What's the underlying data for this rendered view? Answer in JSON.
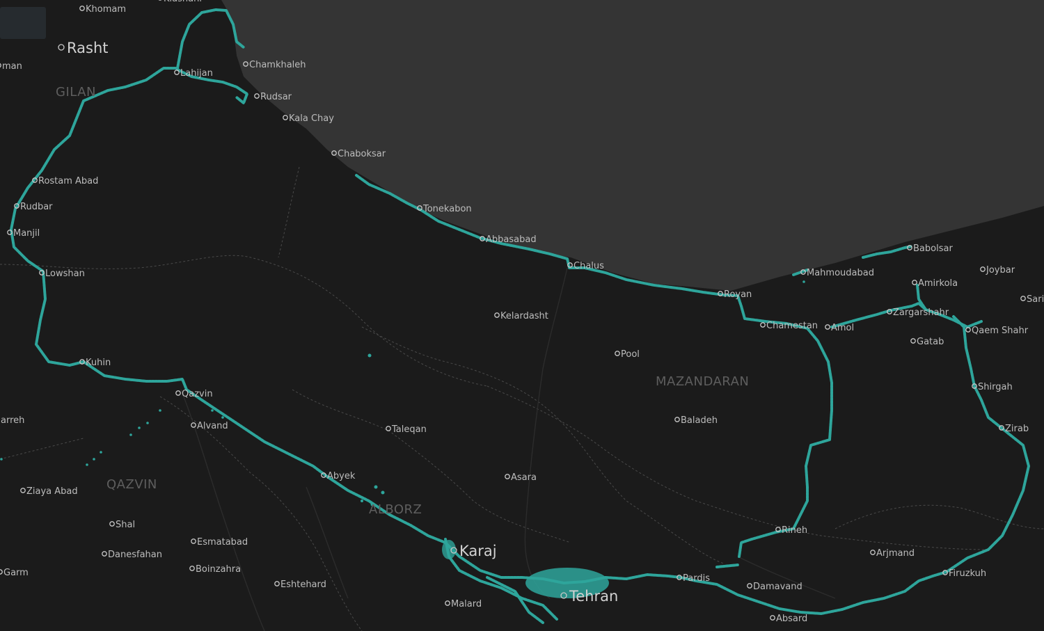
{
  "map": {
    "colors": {
      "land": "#1b1b1b",
      "sea": "#343434",
      "border": "#4a4a4a",
      "route": "#2ea59b",
      "label": "#bdbdbd",
      "region": "#5e5e5e"
    },
    "regions": [
      {
        "id": "gilan",
        "name": "GILAN"
      },
      {
        "id": "mazandaran",
        "name": "MAZANDARAN"
      },
      {
        "id": "qazvin",
        "name": "QAZVIN"
      },
      {
        "id": "alborz",
        "name": "ALBORZ"
      }
    ],
    "cities": [
      {
        "id": "khomam",
        "name": "Khomam"
      },
      {
        "id": "kiashahr",
        "name": "Kiashahr"
      },
      {
        "id": "rasht",
        "name": "Rasht"
      },
      {
        "id": "soman",
        "name": "man"
      },
      {
        "id": "lahijan",
        "name": "Lahijan"
      },
      {
        "id": "chamkhaleh",
        "name": "Chamkhaleh"
      },
      {
        "id": "rudsar",
        "name": "Rudsar"
      },
      {
        "id": "kalachay",
        "name": "Kala Chay"
      },
      {
        "id": "chaboksar",
        "name": "Chaboksar"
      },
      {
        "id": "rostamabad",
        "name": "Rostam Abad"
      },
      {
        "id": "rudbar",
        "name": "Rudbar"
      },
      {
        "id": "manjil",
        "name": "Manjil"
      },
      {
        "id": "lowshan",
        "name": "Lowshan"
      },
      {
        "id": "tonekabon",
        "name": "Tonekabon"
      },
      {
        "id": "abbasabad",
        "name": "Abbasabad"
      },
      {
        "id": "chalus",
        "name": "Chalus"
      },
      {
        "id": "kelardasht",
        "name": "Kelardasht"
      },
      {
        "id": "royan",
        "name": "Royan"
      },
      {
        "id": "chamestan",
        "name": "Chamestan"
      },
      {
        "id": "amol",
        "name": "Amol"
      },
      {
        "id": "mahmoudabad",
        "name": "Mahmoudabad"
      },
      {
        "id": "babolsar",
        "name": "Babolsar"
      },
      {
        "id": "joybar",
        "name": "Joybar"
      },
      {
        "id": "amirkola",
        "name": "Amirkola"
      },
      {
        "id": "sari",
        "name": "Sari"
      },
      {
        "id": "zargarshahr",
        "name": "Zargarshahr"
      },
      {
        "id": "qaemshahr",
        "name": "Qaem Shahr"
      },
      {
        "id": "gatab",
        "name": "Gatab"
      },
      {
        "id": "pool",
        "name": "Pool"
      },
      {
        "id": "shirgah",
        "name": "Shirgah"
      },
      {
        "id": "zirab",
        "name": "Zirab"
      },
      {
        "id": "baladeh",
        "name": "Baladeh"
      },
      {
        "id": "kuhin",
        "name": "Kuhin"
      },
      {
        "id": "qazvincity",
        "name": "Qazvin"
      },
      {
        "id": "alvand",
        "name": "Alvand"
      },
      {
        "id": "taleqan",
        "name": "Taleqan"
      },
      {
        "id": "takestan",
        "name": "arreh"
      },
      {
        "id": "abyek",
        "name": "Abyek"
      },
      {
        "id": "asara",
        "name": "Asara"
      },
      {
        "id": "ziaabad",
        "name": "Ziaya Abad"
      },
      {
        "id": "shal",
        "name": "Shal"
      },
      {
        "id": "esmatabad",
        "name": "Esmatabad"
      },
      {
        "id": "danesfahan",
        "name": "Danesfahan"
      },
      {
        "id": "boinzahra",
        "name": "Boinzahra"
      },
      {
        "id": "garm",
        "name": "Garm"
      },
      {
        "id": "eshtehard",
        "name": "Eshtehard"
      },
      {
        "id": "karaj",
        "name": "Karaj"
      },
      {
        "id": "malard",
        "name": "Malard"
      },
      {
        "id": "tehran",
        "name": "Tehran"
      },
      {
        "id": "pardis",
        "name": "Pardis"
      },
      {
        "id": "damavand",
        "name": "Damavand"
      },
      {
        "id": "absard",
        "name": "Absard"
      },
      {
        "id": "rineh",
        "name": "Rineh"
      },
      {
        "id": "arjmand",
        "name": "Arjmand"
      },
      {
        "id": "firuzkuh",
        "name": "Firuzkuh"
      }
    ]
  }
}
